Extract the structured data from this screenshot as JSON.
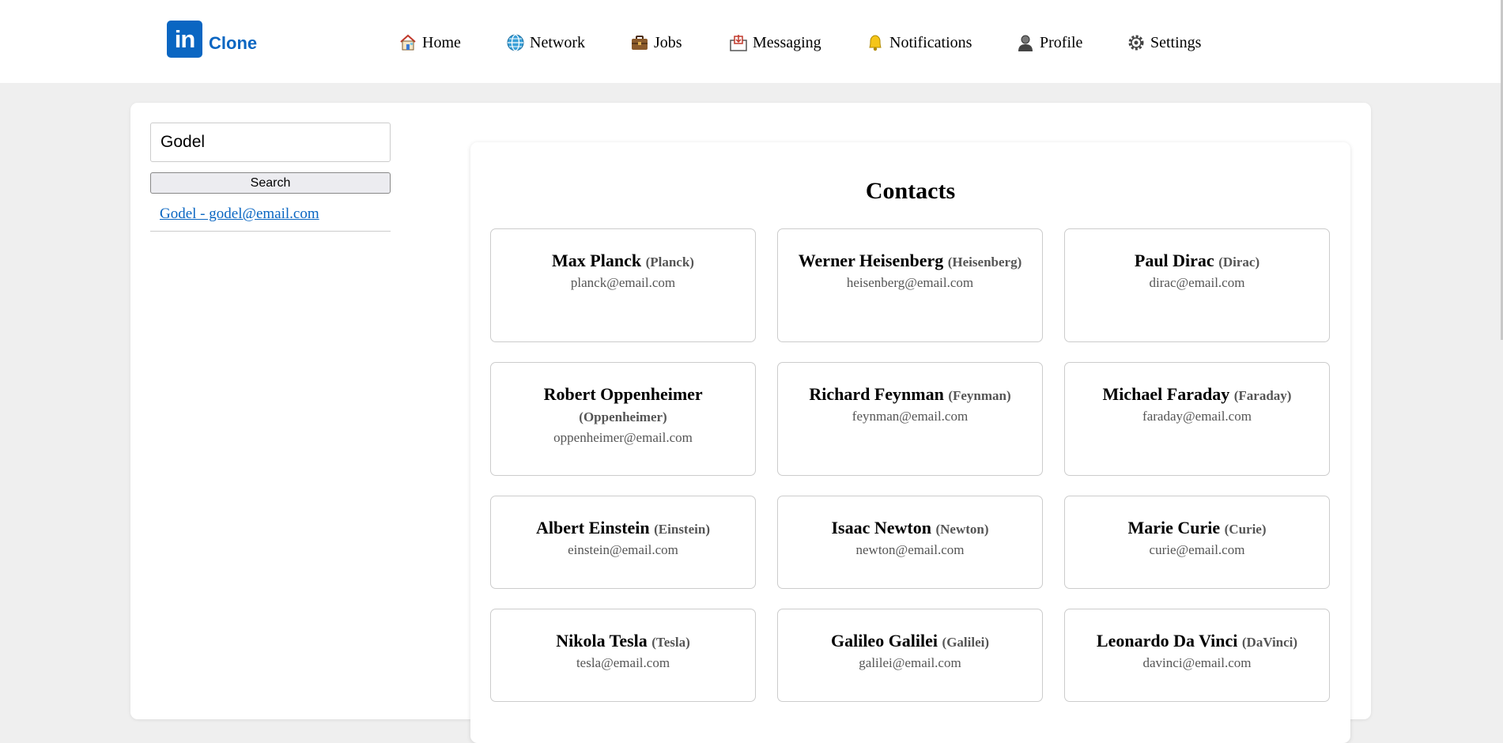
{
  "app": {
    "logo_mark": "in",
    "logo_text": "Clone"
  },
  "nav": [
    {
      "label": "Home",
      "icon": "house-icon"
    },
    {
      "label": "Network",
      "icon": "globe-icon"
    },
    {
      "label": "Jobs",
      "icon": "briefcase-icon"
    },
    {
      "label": "Messaging",
      "icon": "inbox-icon"
    },
    {
      "label": "Notifications",
      "icon": "bell-icon"
    },
    {
      "label": "Profile",
      "icon": "person-icon"
    },
    {
      "label": "Settings",
      "icon": "gear-icon"
    }
  ],
  "search": {
    "value": "Godel",
    "button_label": "Search",
    "results": [
      "Godel - godel@email.com"
    ]
  },
  "contacts": {
    "title": "Contacts",
    "items": [
      {
        "name": "Max Planck",
        "nick": "(Planck)",
        "email": "planck@email.com"
      },
      {
        "name": "Werner Heisenberg",
        "nick": "(Heisenberg)",
        "email": "heisenberg@email.com"
      },
      {
        "name": "Paul Dirac",
        "nick": "(Dirac)",
        "email": "dirac@email.com"
      },
      {
        "name": "Robert Oppenheimer",
        "nick": "(Oppenheimer)",
        "email": "oppenheimer@email.com"
      },
      {
        "name": "Richard Feynman",
        "nick": "(Feynman)",
        "email": "feynman@email.com"
      },
      {
        "name": "Michael Faraday",
        "nick": "(Faraday)",
        "email": "faraday@email.com"
      },
      {
        "name": "Albert Einstein",
        "nick": "(Einstein)",
        "email": "einstein@email.com"
      },
      {
        "name": "Isaac Newton",
        "nick": "(Newton)",
        "email": "newton@email.com"
      },
      {
        "name": "Marie Curie",
        "nick": "(Curie)",
        "email": "curie@email.com"
      },
      {
        "name": "Nikola Tesla",
        "nick": "(Tesla)",
        "email": "tesla@email.com"
      },
      {
        "name": "Galileo Galilei",
        "nick": "(Galilei)",
        "email": "galilei@email.com"
      },
      {
        "name": "Leonardo Da Vinci",
        "nick": "(DaVinci)",
        "email": "davinci@email.com"
      }
    ]
  },
  "colors": {
    "brand": "#0a66c2",
    "page_bg": "#efefef"
  }
}
